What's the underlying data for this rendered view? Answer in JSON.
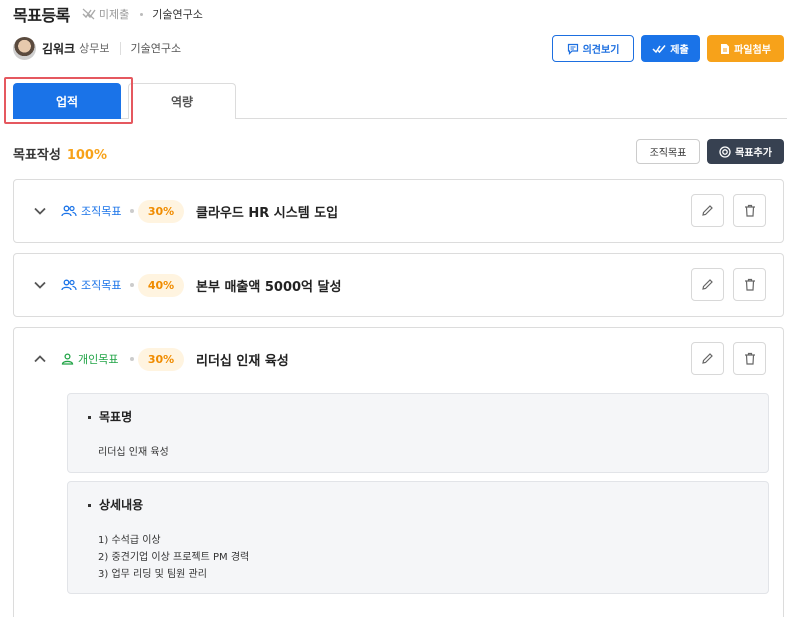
{
  "header": {
    "title": "목표등록",
    "status": "미제출",
    "dept": "기술연구소"
  },
  "user": {
    "name": "김워크",
    "rank": "상무보",
    "dept": "기술연구소"
  },
  "actions": {
    "opinion": "의견보기",
    "submit": "제출",
    "attach": "파일첨부"
  },
  "tabs": [
    {
      "label": "업적",
      "active": true
    },
    {
      "label": "역량",
      "active": false
    }
  ],
  "summary": {
    "label": "목표작성",
    "value": "100%"
  },
  "toolbar": {
    "org_goal": "조직목표",
    "add_goal": "목표추가"
  },
  "goals": [
    {
      "type": "조직목표",
      "percent": "30%",
      "title": "클라우드 HR 시스템 도입",
      "expanded": false
    },
    {
      "type": "조직목표",
      "percent": "40%",
      "title": "본부 매출액 5000억 달성",
      "expanded": false
    },
    {
      "type": "개인목표",
      "percent": "30%",
      "title": "리더십 인재 육성",
      "expanded": true
    }
  ],
  "detail": {
    "name_label": "목표명",
    "name_value": "리더십 인재 육성",
    "content_label": "상세내용",
    "content_lines": [
      "1) 수석급 이상",
      "2) 중견기업 이상 프로젝트 PM 경력",
      "3) 업무 리딩 및 팀원 관리"
    ]
  },
  "colors": {
    "primary": "#1a73e8",
    "accent": "#f7a21a",
    "personal": "#22a447",
    "dark": "#374151"
  }
}
